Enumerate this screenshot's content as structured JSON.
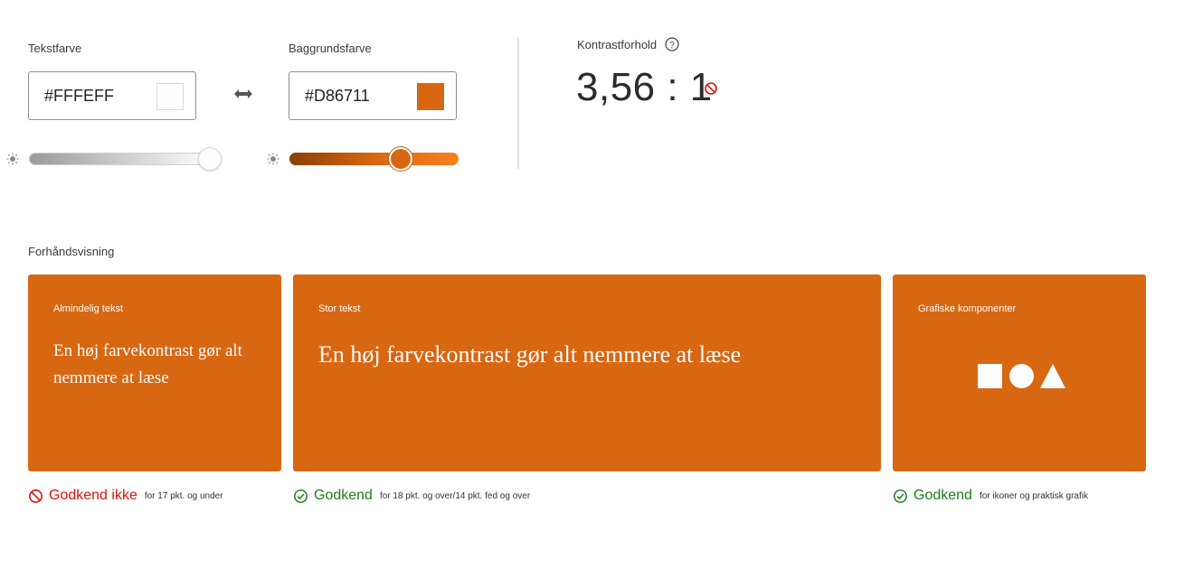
{
  "text_color": {
    "label": "Tekstfarve",
    "value": "#FFFEFF",
    "swatch": "#FFFEFF",
    "brightness": 0.97
  },
  "background_color": {
    "label": "Baggrundsfarve",
    "value": "#D86711",
    "swatch": "#D86711",
    "brightness": 0.66
  },
  "contrast": {
    "label": "Kontrastforhold",
    "help_icon": "question-circle-icon",
    "ratio": "3,56 : 1",
    "status_icon": "not-allowed-icon"
  },
  "preview": {
    "label": "Forhåndsvisning",
    "cards": [
      {
        "title": "Almindelig tekst",
        "sample": "En høj farvekontrast gør alt nemmere at læse"
      },
      {
        "title": "Stor tekst",
        "sample": "En høj farvekontrast gør alt nemmere at læse"
      },
      {
        "title": "Grafiske komponenter",
        "shapes": [
          "square-icon",
          "circle-icon",
          "triangle-icon"
        ]
      }
    ]
  },
  "results": [
    {
      "icon": "not-allowed-icon",
      "verdict": "Godkend ikke",
      "note": "for 17 pkt. og under",
      "status": "fail"
    },
    {
      "icon": "check-circle-icon",
      "verdict": "Godkend",
      "note": "for 18 pkt. og over/14 pkt. fed og over",
      "status": "pass"
    },
    {
      "icon": "check-circle-icon",
      "verdict": "Godkend",
      "note": "for ikoner og praktisk grafik",
      "status": "pass"
    }
  ],
  "colors": {
    "fail": "#d31510",
    "pass": "#1a7d1a",
    "accent": "#D86711"
  }
}
